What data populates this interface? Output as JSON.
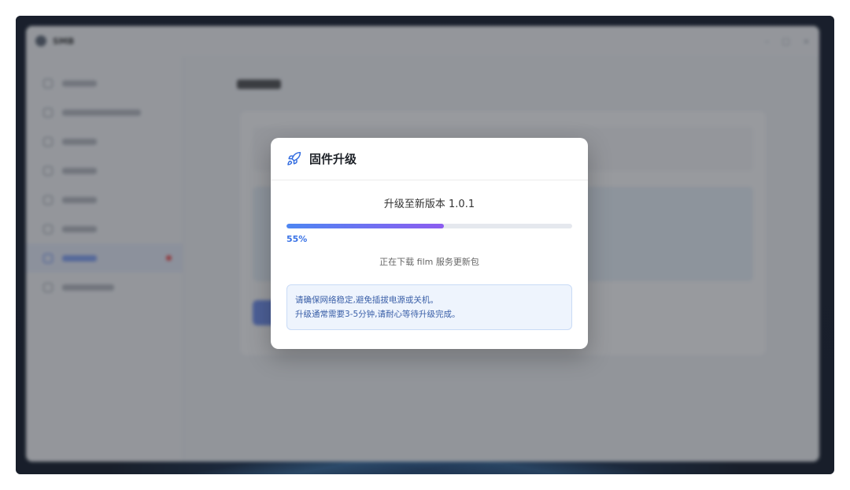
{
  "app": {
    "title": "SMB",
    "window_controls": [
      "–",
      "□",
      "×"
    ]
  },
  "sidebar": {
    "items": [
      {
        "icon": "dashboard-icon",
        "active": false
      },
      {
        "icon": "shield-icon",
        "active": false
      },
      {
        "icon": "user-icon",
        "active": false
      },
      {
        "icon": "calendar-icon",
        "active": false
      },
      {
        "icon": "gear-icon",
        "active": false
      },
      {
        "icon": "wifi-icon",
        "active": false
      },
      {
        "icon": "rocket-icon",
        "active": true,
        "badge": true
      },
      {
        "icon": "box-icon",
        "active": false
      }
    ]
  },
  "dialog": {
    "title": "固件升级",
    "icon": "rocket-icon",
    "version_text": "升级至新版本 1.0.1",
    "progress": {
      "percent": 55,
      "label": "55%"
    },
    "status_text": "正在下载 film 服务更新包",
    "notice": {
      "line1": "请确保网络稳定,避免插拔电源或关机。",
      "line2": "升级通常需要3-5分钟,请耐心等待升级完成。"
    }
  },
  "colors": {
    "accent": "#3a73e6",
    "progress_start": "#4d86f2",
    "progress_end": "#8c5cf0",
    "notice_bg": "#eef4fd",
    "badge": "#f04848"
  }
}
